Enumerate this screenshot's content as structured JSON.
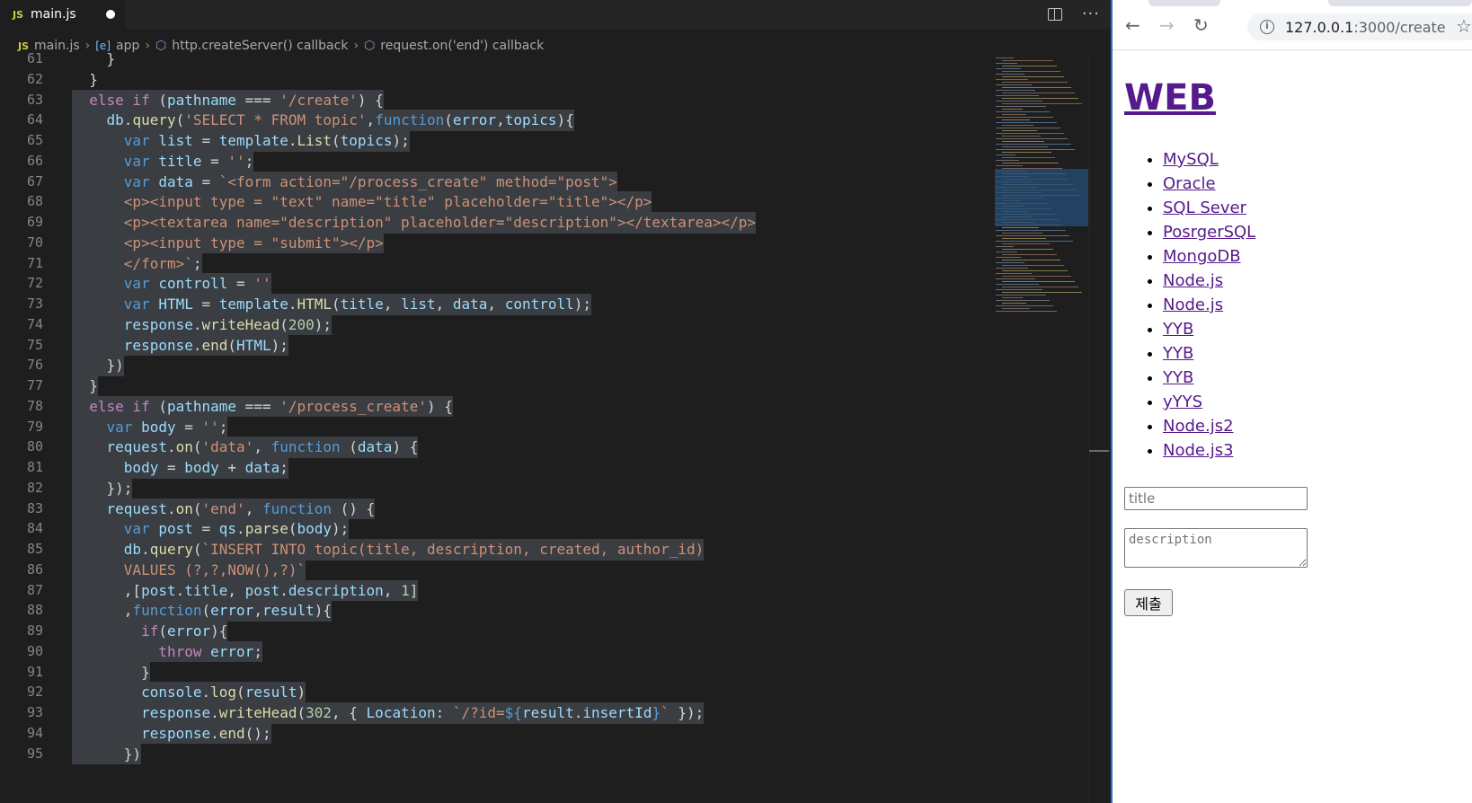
{
  "editor": {
    "tab": {
      "badge": "JS",
      "title": "main.js"
    },
    "breadcrumb": {
      "file_badge": "JS",
      "file": "main.js",
      "var_badge": "[e]",
      "items": [
        "app",
        "http.createServer() callback",
        "request.on('end') callback"
      ]
    },
    "code_lines": [
      {
        "n": "61",
        "html": "<span class=\"p\">    }</span>"
      },
      {
        "n": "62",
        "html": "<span class=\"p\">  }</span>"
      },
      {
        "n": "63",
        "html": "<span class=\"c\">  else if</span><span class=\"p\"> (</span><span class=\"v\">pathname</span><span class=\"p\"> === </span><span class=\"s\">'/create'</span><span class=\"p\">) {</span>"
      },
      {
        "n": "64",
        "html": "<span class=\"p\">    </span><span class=\"v\">db</span><span class=\"p\">.</span><span class=\"f\">query</span><span class=\"p\">(</span><span class=\"s\">'SELECT * FROM topic'</span><span class=\"p\">,</span><span class=\"k\">function</span><span class=\"p\">(</span><span class=\"v\">error</span><span class=\"p\">,</span><span class=\"v\">topics</span><span class=\"p\">){</span>"
      },
      {
        "n": "65",
        "html": "<span class=\"p\">      </span><span class=\"k\">var</span><span class=\"p\"> </span><span class=\"v\">list</span><span class=\"p\"> = </span><span class=\"v\">template</span><span class=\"p\">.</span><span class=\"f\">List</span><span class=\"p\">(</span><span class=\"v\">topics</span><span class=\"p\">);</span>"
      },
      {
        "n": "66",
        "html": "<span class=\"p\">      </span><span class=\"k\">var</span><span class=\"p\"> </span><span class=\"v\">title</span><span class=\"p\"> = </span><span class=\"s\">''</span><span class=\"p\">;</span>"
      },
      {
        "n": "67",
        "html": "<span class=\"p\">      </span><span class=\"k\">var</span><span class=\"p\"> </span><span class=\"v\">data</span><span class=\"p\"> = </span><span class=\"s\">`&lt;form action=\"/process_create\" method=\"post\"&gt;</span>"
      },
      {
        "n": "68",
        "html": "<span class=\"s\">      &lt;p&gt;&lt;input type = \"text\" name=\"title\" placeholder=\"title\"&gt;&lt;/p&gt;</span>"
      },
      {
        "n": "69",
        "html": "<span class=\"s\">      &lt;p&gt;&lt;textarea name=\"description\" placeholder=\"description\"&gt;&lt;/textarea&gt;&lt;/p&gt;</span>"
      },
      {
        "n": "70",
        "html": "<span class=\"s\">      &lt;p&gt;&lt;input type = \"submit\"&gt;&lt;/p&gt;</span>"
      },
      {
        "n": "71",
        "html": "<span class=\"s\">      &lt;/form&gt;`</span><span class=\"p\">;</span>"
      },
      {
        "n": "72",
        "html": "<span class=\"p\">      </span><span class=\"k\">var</span><span class=\"p\"> </span><span class=\"v\">controll</span><span class=\"p\"> = </span><span class=\"s\">''</span>"
      },
      {
        "n": "73",
        "html": "<span class=\"p\">      </span><span class=\"k\">var</span><span class=\"p\"> </span><span class=\"v\">HTML</span><span class=\"p\"> = </span><span class=\"v\">template</span><span class=\"p\">.</span><span class=\"f\">HTML</span><span class=\"p\">(</span><span class=\"v\">title</span><span class=\"p\">, </span><span class=\"v\">list</span><span class=\"p\">, </span><span class=\"v\">data</span><span class=\"p\">, </span><span class=\"v\">controll</span><span class=\"p\">);</span>"
      },
      {
        "n": "74",
        "html": "<span class=\"p\">      </span><span class=\"v\">response</span><span class=\"p\">.</span><span class=\"f\">writeHead</span><span class=\"p\">(</span><span class=\"n\">200</span><span class=\"p\">);</span>"
      },
      {
        "n": "75",
        "html": "<span class=\"p\">      </span><span class=\"v\">response</span><span class=\"p\">.</span><span class=\"f\">end</span><span class=\"p\">(</span><span class=\"v\">HTML</span><span class=\"p\">);</span>"
      },
      {
        "n": "76",
        "html": "<span class=\"p\">    })</span>"
      },
      {
        "n": "77",
        "html": "<span class=\"p\">  }</span>"
      },
      {
        "n": "78",
        "html": "<span class=\"c\">  else if</span><span class=\"p\"> (</span><span class=\"v\">pathname</span><span class=\"p\"> === </span><span class=\"s\">'/process_create'</span><span class=\"p\">) {</span>"
      },
      {
        "n": "79",
        "html": "<span class=\"p\">    </span><span class=\"k\">var</span><span class=\"p\"> </span><span class=\"v\">body</span><span class=\"p\"> = </span><span class=\"s\">''</span><span class=\"p\">;</span>"
      },
      {
        "n": "80",
        "html": "<span class=\"p\">    </span><span class=\"v\">request</span><span class=\"p\">.</span><span class=\"f\">on</span><span class=\"p\">(</span><span class=\"s\">'data'</span><span class=\"p\">, </span><span class=\"k\">function</span><span class=\"p\"> (</span><span class=\"v\">data</span><span class=\"p\">) {</span>"
      },
      {
        "n": "81",
        "html": "<span class=\"p\">      </span><span class=\"v\">body</span><span class=\"p\"> = </span><span class=\"v\">body</span><span class=\"p\"> + </span><span class=\"v\">data</span><span class=\"p\">;</span>"
      },
      {
        "n": "82",
        "html": "<span class=\"p\">    });</span>"
      },
      {
        "n": "83",
        "html": "<span class=\"p\">    </span><span class=\"v\">request</span><span class=\"p\">.</span><span class=\"f\">on</span><span class=\"p\">(</span><span class=\"s\">'end'</span><span class=\"p\">, </span><span class=\"k\">function</span><span class=\"p\"> () {</span>"
      },
      {
        "n": "84",
        "html": "<span class=\"p\">      </span><span class=\"k\">var</span><span class=\"p\"> </span><span class=\"v\">post</span><span class=\"p\"> = </span><span class=\"v\">qs</span><span class=\"p\">.</span><span class=\"f\">parse</span><span class=\"p\">(</span><span class=\"v\">body</span><span class=\"p\">);</span>"
      },
      {
        "n": "85",
        "html": "<span class=\"p\">      </span><span class=\"v\">db</span><span class=\"p\">.</span><span class=\"f\">query</span><span class=\"p\">(</span><span class=\"s\">`INSERT INTO topic(title, description, created, author_id)</span>"
      },
      {
        "n": "86",
        "html": "<span class=\"s\">      VALUES (?,?,NOW(),?)`</span>"
      },
      {
        "n": "87",
        "html": "<span class=\"p\">      ,[</span><span class=\"v\">post</span><span class=\"p\">.</span><span class=\"v\">title</span><span class=\"p\">, </span><span class=\"v\">post</span><span class=\"p\">.</span><span class=\"v\">description</span><span class=\"p\">, </span><span class=\"n\">1</span><span class=\"p\">]</span>"
      },
      {
        "n": "88",
        "html": "<span class=\"p\">      ,</span><span class=\"k\">function</span><span class=\"p\">(</span><span class=\"v\">error</span><span class=\"p\">,</span><span class=\"v\">result</span><span class=\"p\">){</span>"
      },
      {
        "n": "89",
        "html": "<span class=\"p\">        </span><span class=\"c\">if</span><span class=\"p\">(</span><span class=\"v\">error</span><span class=\"p\">){</span>"
      },
      {
        "n": "90",
        "html": "<span class=\"p\">          </span><span class=\"c\">throw</span><span class=\"p\"> </span><span class=\"v\">error</span><span class=\"p\">;</span>"
      },
      {
        "n": "91",
        "html": "<span class=\"p\">        }</span>"
      },
      {
        "n": "92",
        "html": "<span class=\"p\">        </span><span class=\"v\">console</span><span class=\"p\">.</span><span class=\"f\">log</span><span class=\"p\">(</span><span class=\"v\">result</span><span class=\"p\">)</span>"
      },
      {
        "n": "93",
        "html": "<span class=\"p\">        </span><span class=\"v\">response</span><span class=\"p\">.</span><span class=\"f\">writeHead</span><span class=\"p\">(</span><span class=\"n\">302</span><span class=\"p\">, { </span><span class=\"v\">Location</span><span class=\"p\">: </span><span class=\"s\">`/?id=</span><span class=\"k\">${</span><span class=\"v\">result</span><span class=\"p\">.</span><span class=\"v\">insertId</span><span class=\"k\">}</span><span class=\"s\">`</span><span class=\"p\"> });</span>"
      },
      {
        "n": "94",
        "html": "<span class=\"p\">        </span><span class=\"v\">response</span><span class=\"p\">.</span><span class=\"f\">end</span><span class=\"p\">();</span>"
      },
      {
        "n": "95",
        "html": "<span class=\"p\">      })</span>"
      }
    ]
  },
  "browser": {
    "url_host": "127.0.0.1",
    "url_path": ":3000/create",
    "page": {
      "heading": "WEB",
      "topics": [
        "MySQL",
        "Oracle",
        "SQL Sever",
        "PosrgerSQL",
        "MongoDB",
        "Node.js",
        "Node.js",
        "YYB",
        "YYB",
        "YYB",
        "yYYS",
        "Node.js2",
        "Node.js3"
      ],
      "title_placeholder": "title",
      "description_placeholder": "description",
      "submit_label": "제출"
    }
  }
}
